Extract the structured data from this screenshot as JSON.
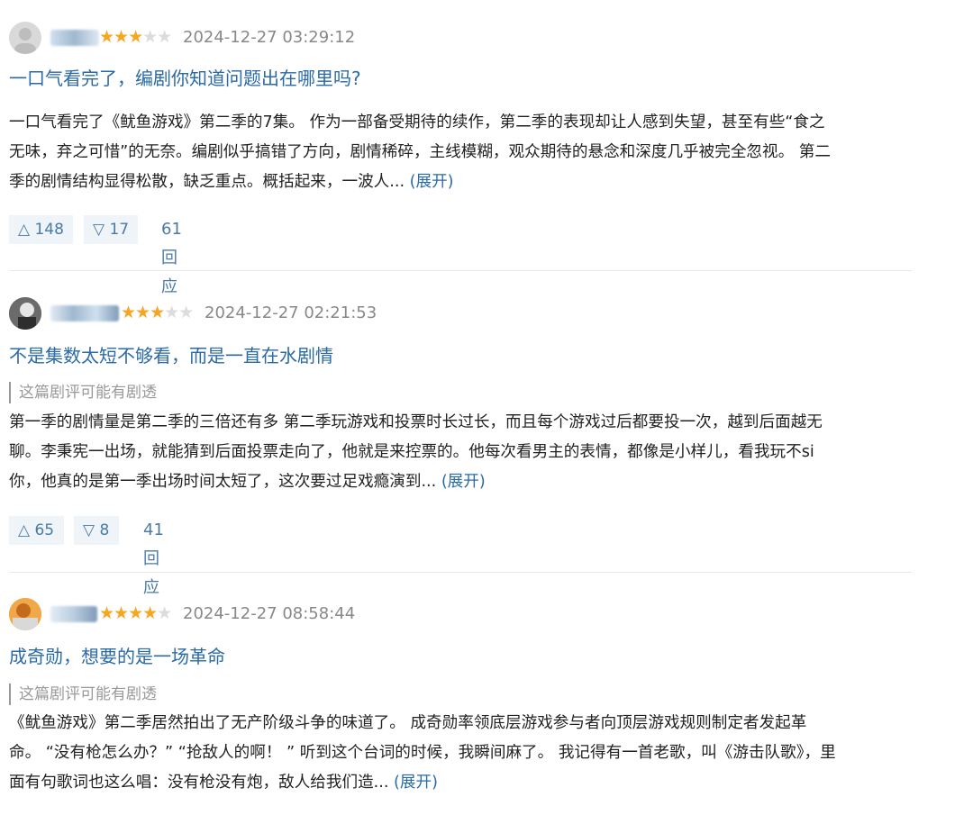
{
  "reviews": [
    {
      "rating": 3,
      "stars_filled": "★★★",
      "stars_empty": "★★",
      "time": "2024-12-27 03:29:12",
      "title": "一口气看完了，编剧你知道问题出在哪里吗?",
      "spoiler": "",
      "body_lines": [
        "一口气看完了《鱿鱼游戏》第二季的7集。 作为一部备受期待的续作，第二季的表现却让人感到失望，甚至有些“食之",
        "无味，弃之可惜”的无奈。编剧似乎搞错了方向，剧情稀碎，主线模糊，观众期待的悬念和深度几乎被完全忽视。 第二",
        "季的剧情结构显得松散，缺乏重点。概括起来，一波人... "
      ],
      "more_label": "(展开)",
      "up_label": "△ 148",
      "down_label": "▽ 17",
      "replies_label": "61回应"
    },
    {
      "rating": 3,
      "stars_filled": "★★★",
      "stars_empty": "★★",
      "time": "2024-12-27 02:21:53",
      "title": "不是集数太短不够看，而是一直在水剧情",
      "spoiler": "这篇剧评可能有剧透",
      "body_lines": [
        "第一季的剧情量是第二季的三倍还有多 第二季玩游戏和投票时长过长，而且每个游戏过后都要投一次，越到后面越无",
        "聊。李秉宪一出场，就能猜到后面投票走向了，他就是来控票的。他每次看男主的表情，都像是小样儿，看我玩不si",
        "你，他真的是第一季出场时间太短了，这次要过足戏瘾演到... "
      ],
      "more_label": "(展开)",
      "up_label": "△ 65",
      "down_label": "▽ 8",
      "replies_label": "41回应"
    },
    {
      "rating": 4,
      "stars_filled": "★★★★",
      "stars_empty": "★",
      "time": "2024-12-27 08:58:44",
      "title": "成奇勋，想要的是一场革命",
      "spoiler": "这篇剧评可能有剧透",
      "body_lines": [
        "《鱿鱼游戏》第二季居然拍出了无产阶级斗争的味道了。 成奇勋率领底层游戏参与者向顶层游戏规则制定者发起革",
        "命。 “没有枪怎么办？” “抢敌人的啊！ ” 听到这个台词的时候，我瞬间麻了。 我记得有一首老歌，叫《游击队歌》，里",
        "面有句歌词也这么唱：没有枪没有炮，敌人给我们造... "
      ],
      "more_label": "(展开)",
      "up_label": "",
      "down_label": "",
      "replies_label": ""
    }
  ]
}
